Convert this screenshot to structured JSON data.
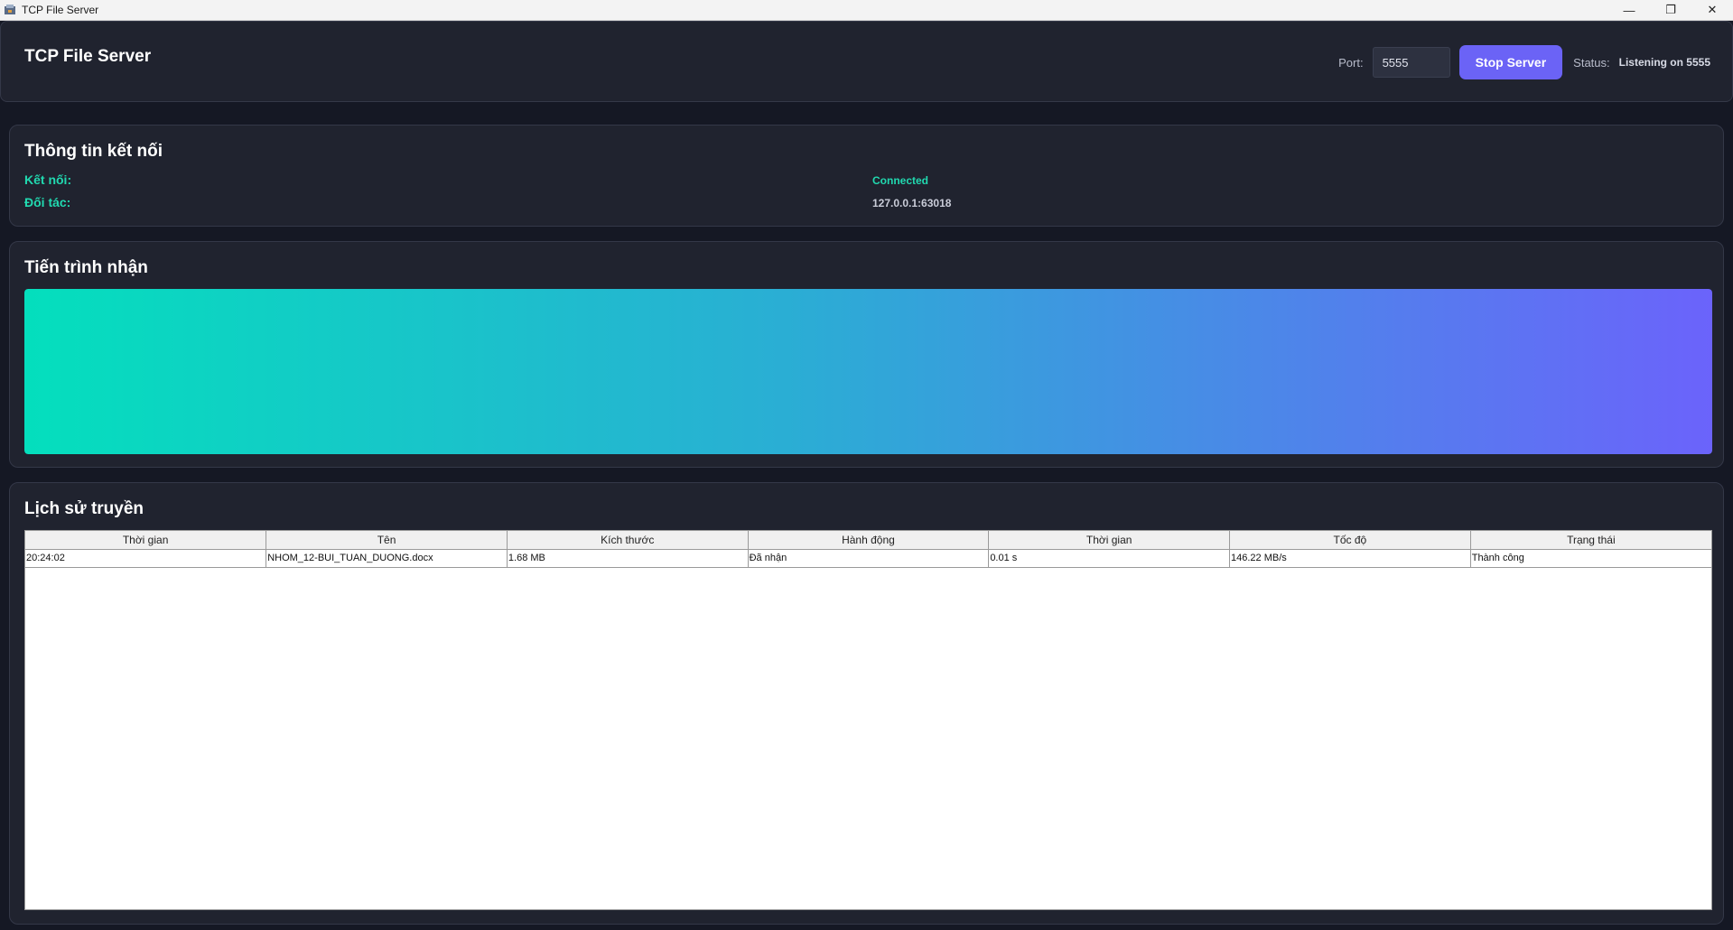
{
  "window": {
    "title": "TCP File Server",
    "minimize": "—",
    "restore": "❐",
    "close": "✕"
  },
  "header": {
    "title": "TCP File Server",
    "port_label": "Port:",
    "port_value": "5555",
    "stop_label": "Stop Server",
    "status_label": "Status:",
    "status_value": "Listening on 5555"
  },
  "connection": {
    "title": "Thông tin kết nối",
    "rows": [
      {
        "label": "Kết nối:",
        "value": "Connected",
        "color": "#21d9b0"
      },
      {
        "label": "Đối tác:",
        "value": "127.0.0.1:63018",
        "color": "#c9ccd8"
      }
    ]
  },
  "progress": {
    "title": "Tiến trình nhận",
    "percent": 100
  },
  "history": {
    "title": "Lịch sử truyền",
    "columns": [
      "Thời gian",
      "Tên",
      "Kích thước",
      "Hành động",
      "Thời gian",
      "Tốc độ",
      "Trạng thái"
    ],
    "rows": [
      [
        "20:24:02",
        "NHOM_12-BUI_TUAN_DUONG.docx",
        "1.68 MB",
        "Đã nhận",
        "0.01 s",
        "146.22 MB/s",
        "Thành công"
      ]
    ]
  },
  "colors": {
    "accent": "#6b63f6",
    "teal": "#21d9b0",
    "bg": "#151824",
    "panel": "#20232f"
  }
}
